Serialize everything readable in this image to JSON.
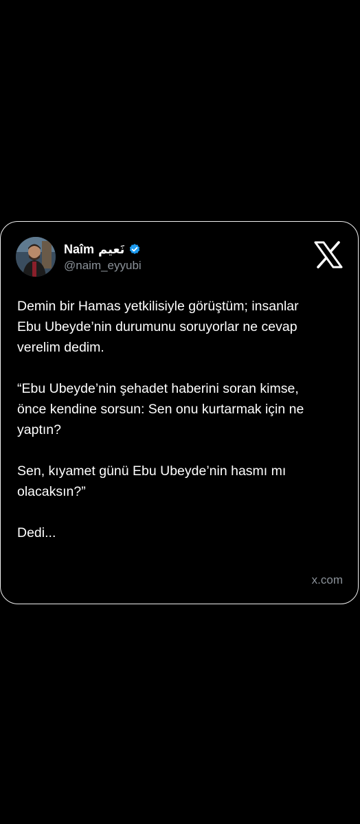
{
  "tweet": {
    "author": {
      "display_name": "Naîm",
      "arabic_name": "نَعيم",
      "handle": "@naim_eyyubi",
      "verified": true,
      "verified_color": "#1d9bf0"
    },
    "paragraphs": [
      "Demin bir Hamas yetkilisiyle görüştüm; insanlar\nEbu Ubeyde’nin durumunu soruyorlar ne cevap\nverelim dedim.",
      "“Ebu Ubeyde’nin şehadet haberini soran kimse,\nönce kendine sorsun: Sen onu kurtarmak için ne\nyaptın?",
      "Sen, kıyamet günü Ebu Ubeyde’nin hasmı mı\nolacaksın?”",
      "Dedi..."
    ],
    "source": "x.com"
  },
  "icons": {
    "platform_logo": "x-logo-icon",
    "verified": "verified-badge-icon"
  },
  "colors": {
    "background": "#000000",
    "card_border": "#f2f2f2",
    "text": "#ffffff",
    "secondary_text": "#8b9299"
  }
}
